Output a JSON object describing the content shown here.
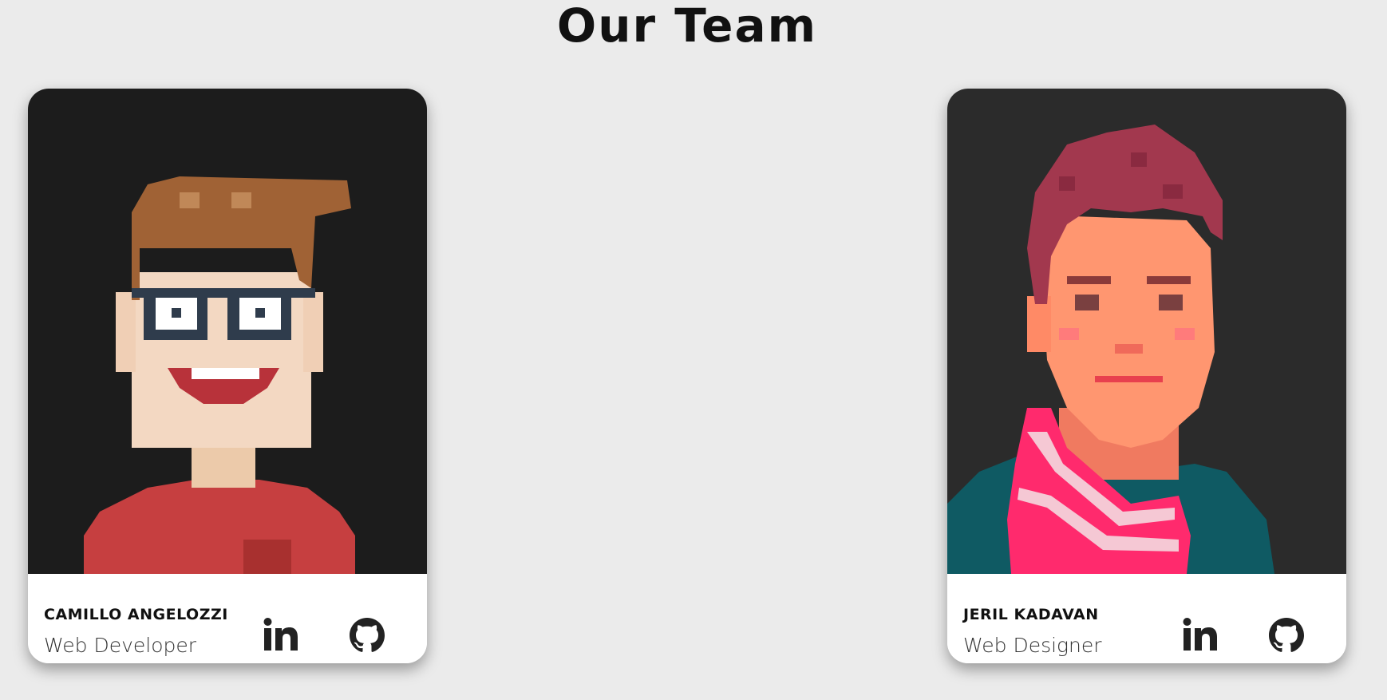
{
  "page": {
    "title": "Our Team"
  },
  "team": [
    {
      "name": "CAMILLO ANGELOZZI",
      "role": "Web Developer",
      "icons": [
        "linkedin-icon",
        "github-icon"
      ]
    },
    {
      "name": "JERIL KADAVAN",
      "role": "Web Designer",
      "icons": [
        "linkedin-icon",
        "github-icon"
      ]
    }
  ],
  "colors": {
    "background": "#ebebeb",
    "card_photo_bg_1": "#1c1c1c",
    "card_photo_bg_2": "#2b2b2b",
    "text": "#111111"
  }
}
